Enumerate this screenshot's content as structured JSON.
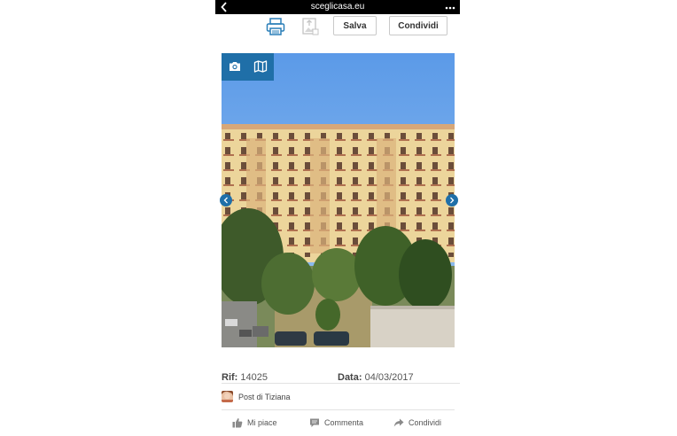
{
  "browser": {
    "url": "sceglicasa.eu",
    "back_icon": "chevron-left-icon",
    "menu_icon": "more-dots-icon"
  },
  "toolbar": {
    "print_icon": "printer-icon",
    "upload_icon": "image-upload-icon",
    "save_label": "Salva",
    "share_label": "Condividi"
  },
  "gallery": {
    "view_icons": [
      "camera-icon",
      "map-icon"
    ],
    "nav_icons": [
      "arrow-left-icon",
      "arrow-right-icon"
    ],
    "accent_color": "#1f6fa8"
  },
  "listing": {
    "ref_label": "Rif:",
    "ref_value": "14025",
    "date_label": "Data:",
    "date_value": "04/03/2017"
  },
  "post": {
    "author_text": "Post di Tiziana"
  },
  "actions": {
    "like_label": "Mi piace",
    "comment_label": "Commenta",
    "share_label": "Condividi"
  }
}
